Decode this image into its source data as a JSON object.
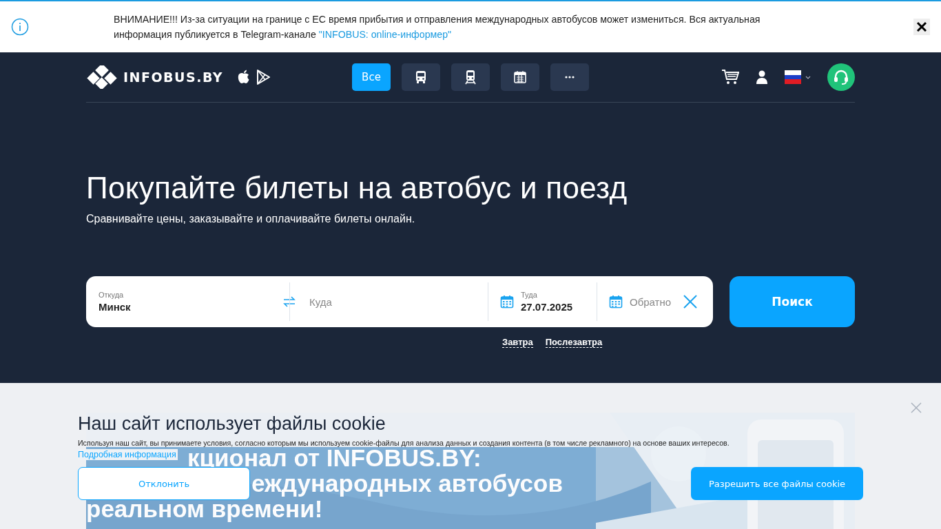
{
  "notice": {
    "text": "ВНИМАНИЕ!!! Из-за ситуации на границе с ЕС время прибытия и отправления международных автобусов может измениться. Вся актуальная информация публикуется в Telegram-канале",
    "link": "\"INFOBUS: online-информер\""
  },
  "header": {
    "logo": "INFOBUS.BY",
    "nav": [
      {
        "kind": "text",
        "label": "Все",
        "selected": true
      },
      {
        "kind": "bus",
        "selected": false
      },
      {
        "kind": "train",
        "selected": false
      },
      {
        "kind": "calendar",
        "selected": false
      },
      {
        "kind": "more",
        "selected": false
      }
    ]
  },
  "hero": {
    "title": "Покупайте билеты на автобус и поезд",
    "subtitle": "Сравнивайте цены, заказывайте и оплачивайте билеты онлайн."
  },
  "search": {
    "from": {
      "label": "Откуда",
      "value": "Минск"
    },
    "to": {
      "placeholder": "Куда"
    },
    "depart": {
      "label": "Туда",
      "value": "27.07.2025"
    },
    "return": {
      "placeholder": "Обратно"
    },
    "button": "Поиск",
    "quick_dates": [
      "Завтра",
      "Послезавтра"
    ]
  },
  "promo": {
    "lines": [
      "кционал от INFOBUS.BY:",
      "еждународных автобусов",
      "реальном времени!"
    ]
  },
  "cookie": {
    "title": "Наш сайт использует файлы cookie",
    "text": "Используя наш сайт, вы принимаете условия, согласно которым мы используем cookie-файлы для анализа данных и создания контента (в том числе рекламного) на основе ваших интересов.",
    "link": "Подробная информация",
    "decline": "Отклонить",
    "accept": "Разрешить все файлы cookie"
  }
}
